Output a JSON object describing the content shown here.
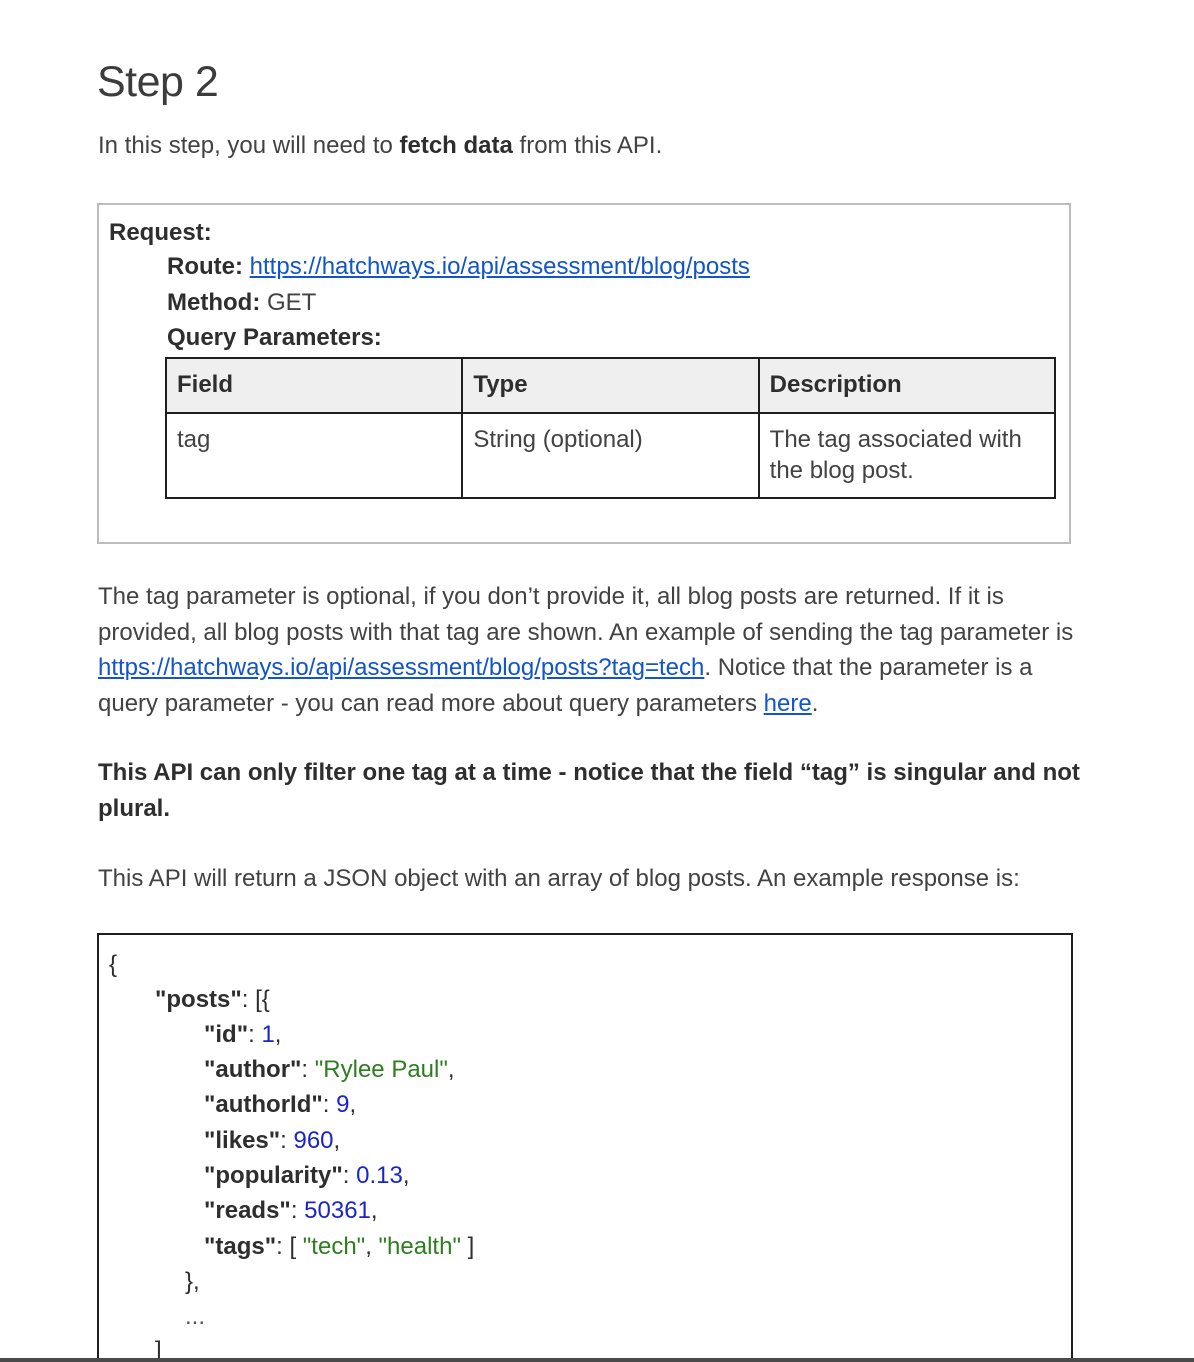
{
  "heading": "Step 2",
  "intro": {
    "before": "In this step, you will need to ",
    "bold": "fetch data",
    "after": " from this API."
  },
  "request": {
    "title": "Request:",
    "route_label": "Route:",
    "route_url": "https://hatchways.io/api/assessment/blog/posts",
    "method_label": "Method:",
    "method_value": "GET",
    "query_label": "Query Parameters:",
    "table": {
      "headers": [
        "Field",
        "Type",
        "Description"
      ],
      "rows": [
        [
          "tag",
          "String (optional)",
          "The tag associated with the blog post."
        ]
      ]
    }
  },
  "paragraph1": {
    "text1": "The tag parameter is optional, if you don’t provide it, all blog posts are returned. If it is provided, all blog posts with that tag are shown. An example of sending the tag parameter is ",
    "link1": "https://hatchways.io/api/assessment/blog/posts?tag=tech",
    "text2": ". Notice that the parameter is a query parameter -  you can read more about query parameters ",
    "link2": "here",
    "text3": "."
  },
  "paragraph2": "This API can only filter one tag at a time - notice that the field “tag” is singular and not plural.",
  "paragraph3": "This API will return a JSON object with an array of blog posts. An example response is:",
  "code": {
    "open_brace": "{",
    "posts_key": "\"posts\"",
    "posts_open": ": [{",
    "id_key": "\"id\"",
    "id_value": "1",
    "author_key": "\"author\"",
    "author_value": "\"Rylee Paul\"",
    "authorId_key": "\"authorId\"",
    "authorId_value": "9",
    "likes_key": "\"likes\"",
    "likes_value": "960",
    "popularity_key": "\"popularity\"",
    "popularity_value": "0.13",
    "reads_key": "\"reads\"",
    "reads_value": "50361",
    "tags_key": "\"tags\"",
    "tags_value_1": "\"tech\"",
    "tags_value_2": "\"health\"",
    "close_obj": "},",
    "ellipsis": "...",
    "close_array": "]"
  }
}
